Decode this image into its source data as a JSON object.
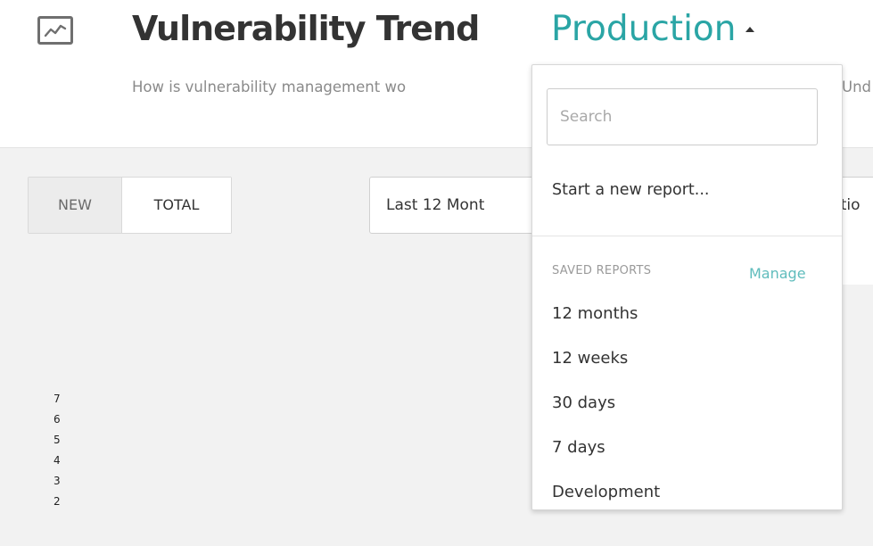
{
  "header": {
    "title": "Vulnerability Trend",
    "report_name": "Production",
    "subtitle": "How is vulnerability management wo",
    "subtitle_tail": "Und"
  },
  "toolbar": {
    "toggle": {
      "new_label": "NEW",
      "total_label": "TOTAL",
      "selected": "NEW"
    },
    "range_value": "Last 12 Mont",
    "location_value": "catio"
  },
  "chart": {
    "y_ticks": [
      "7",
      "6",
      "5",
      "4",
      "3",
      "2"
    ]
  },
  "dropdown": {
    "search_placeholder": "Search",
    "new_report_label": "Start a new report...",
    "saved_reports_label": "SAVED REPORTS",
    "manage_label": "Manage",
    "saved_reports": [
      {
        "label": "12 months"
      },
      {
        "label": "12 weeks"
      },
      {
        "label": "30 days"
      },
      {
        "label": "7 days"
      },
      {
        "label": "Development"
      }
    ]
  },
  "colors": {
    "accent": "#2aa5a5",
    "manage_link": "#5fbcbc",
    "background_main": "#f2f2f2"
  },
  "icons": {
    "title_icon": "trend-chart-icon",
    "report_caret": "caret-up-icon"
  }
}
